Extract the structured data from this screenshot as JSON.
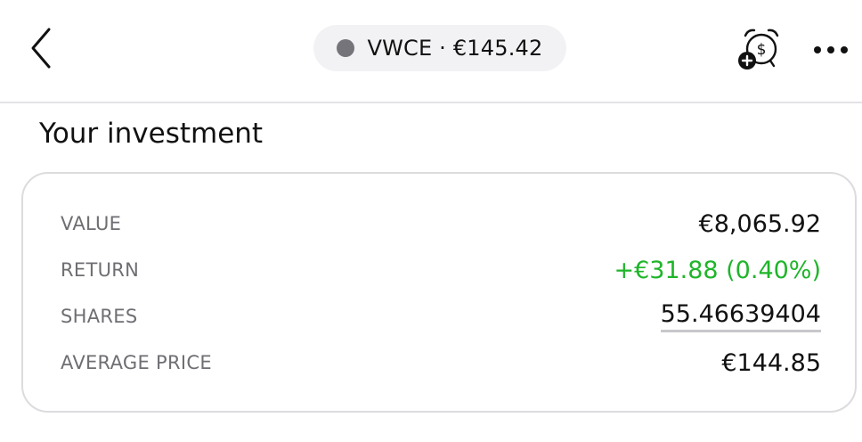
{
  "header": {
    "back_icon": "chevron-left-icon",
    "ticker_label": "VWCE · €145.42",
    "ticker_dot_color": "#74747a",
    "alert_icon": "price-alert-add-icon",
    "more_icon": "more-horizontal-icon"
  },
  "investment": {
    "title": "Your investment",
    "rows": [
      {
        "label": "VALUE",
        "value": "€8,065.92"
      },
      {
        "label": "RETURN",
        "value": "+€31.88 (0.40%)",
        "color": "#1fb52a"
      },
      {
        "label": "SHARES",
        "value": "55.46639404"
      },
      {
        "label": "AVERAGE PRICE",
        "value": "€144.85"
      }
    ]
  }
}
